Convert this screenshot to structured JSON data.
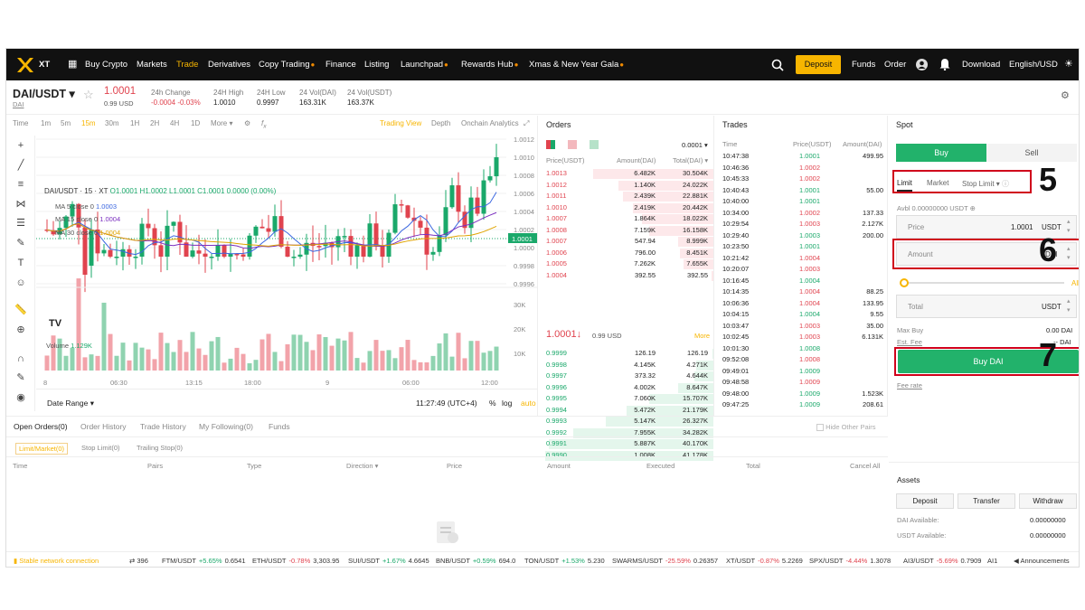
{
  "nav": {
    "logo": "XT",
    "items": [
      "Buy Crypto",
      "Markets",
      "Trade",
      "Derivatives",
      "Copy Trading",
      "Finance",
      "Listing",
      "Launchpad",
      "Rewards Hub",
      "Xmas & New Year Gala"
    ],
    "deposit": "Deposit",
    "funds": "Funds",
    "order": "Order",
    "download": "Download",
    "locale": "English/USD"
  },
  "pair": {
    "name": "DAI/USDT",
    "base": "DAI",
    "price": "1.0001",
    "price_usd": "0.99 USD",
    "change_label": "24h Change",
    "change_value": "-0.0004 -0.03%",
    "high_label": "24H High",
    "high_value": "1.0010",
    "low_label": "24H Low",
    "low_value": "0.9997",
    "vol_label": "24 Vol(DAI)",
    "vol_value": "163.31K",
    "vol2_label": "24 Vol(USDT)",
    "vol2_value": "163.37K"
  },
  "chart": {
    "timeframes": [
      "Time",
      "1m",
      "5m",
      "15m",
      "30m",
      "1H",
      "2H",
      "4H",
      "1D",
      "More"
    ],
    "views": [
      "Trading View",
      "Depth",
      "Onchain Analytics"
    ],
    "legend_title": "DAI/USDT · 15 · XT",
    "ohlc": "O1.0001 H1.0002 L1.0001 C1.0001 0.0000 (0.00%)",
    "ma5": "MA 5 close 0",
    "ma5_val": "1.0003",
    "ma15": "MA 15 close 0",
    "ma15_val": "1.0004",
    "ma30": "MA 30 close 0",
    "ma30_val": "1.0004",
    "yticks": [
      "1.0012",
      "1.0010",
      "1.0008",
      "1.0006",
      "1.0004",
      "1.0002",
      "1.0000",
      "0.9998",
      "0.9996"
    ],
    "current": "1.0001",
    "volume_label": "Volume",
    "volume_val": "1.129K",
    "vticks": [
      "30K",
      "20K",
      "10K"
    ],
    "xticks": [
      "8",
      "06:30",
      "13:15",
      "18:00",
      "9",
      "06:00",
      "12:00"
    ],
    "date_range": "Date Range",
    "clock": "11:27:49 (UTC+4)",
    "pct": "%",
    "log": "log",
    "auto": "auto"
  },
  "chart_data": {
    "type": "candlestick",
    "title": "DAI/USDT · 15 · XT",
    "ylim": [
      0.9996,
      1.0012
    ],
    "last": 1.0001
  },
  "orders": {
    "title": "Orders",
    "precision": "0.0001",
    "headers": [
      "Price(USDT)",
      "Amount(DAI)",
      "Total(DAI)"
    ],
    "asks": [
      [
        "1.0013",
        "6.482K",
        "30.504K"
      ],
      [
        "1.0012",
        "1.140K",
        "24.022K"
      ],
      [
        "1.0011",
        "2.439K",
        "22.881K"
      ],
      [
        "1.0010",
        "2.419K",
        "20.442K"
      ],
      [
        "1.0007",
        "1.864K",
        "18.022K"
      ],
      [
        "1.0008",
        "7.159K",
        "16.158K"
      ],
      [
        "1.0007",
        "547.94",
        "8.999K"
      ],
      [
        "1.0006",
        "796.00",
        "8.451K"
      ],
      [
        "1.0005",
        "7.262K",
        "7.655K"
      ],
      [
        "1.0004",
        "392.55",
        "392.55"
      ]
    ],
    "mid_price": "1.0001↓",
    "mid_usd": "0.99 USD",
    "more": "More",
    "bids": [
      [
        "0.9999",
        "126.19",
        "126.19"
      ],
      [
        "0.9998",
        "4.145K",
        "4.271K"
      ],
      [
        "0.9997",
        "373.32",
        "4.644K"
      ],
      [
        "0.9996",
        "4.002K",
        "8.647K"
      ],
      [
        "0.9995",
        "7.060K",
        "15.707K"
      ],
      [
        "0.9994",
        "5.472K",
        "21.179K"
      ],
      [
        "0.9993",
        "5.147K",
        "26.327K"
      ],
      [
        "0.9992",
        "7.955K",
        "34.282K"
      ],
      [
        "0.9991",
        "5.887K",
        "40.170K"
      ],
      [
        "0.9990",
        "1.008K",
        "41.178K"
      ]
    ]
  },
  "trades": {
    "title": "Trades",
    "headers": [
      "Time",
      "Price(USDT)",
      "Amount(DAI)"
    ],
    "rows": [
      [
        "10:47:38",
        "1.0001",
        "499.95",
        "g"
      ],
      [
        "10:46:36",
        "1.0002",
        "",
        "r"
      ],
      [
        "10:45:33",
        "1.0002",
        "",
        "r"
      ],
      [
        "10:40:43",
        "1.0001",
        "55.00",
        "g"
      ],
      [
        "10:40:00",
        "1.0001",
        "",
        "g"
      ],
      [
        "10:34:00",
        "1.0002",
        "137.33",
        "r"
      ],
      [
        "10:29:54",
        "1.0003",
        "2.127K",
        "r"
      ],
      [
        "10:29:40",
        "1.0003",
        "200.00",
        "g"
      ],
      [
        "10:23:50",
        "1.0001",
        "",
        "g"
      ],
      [
        "10:21:42",
        "1.0004",
        "",
        "r"
      ],
      [
        "10:20:07",
        "1.0003",
        "",
        "r"
      ],
      [
        "10:16:45",
        "1.0004",
        "",
        "g"
      ],
      [
        "10:14:35",
        "1.0004",
        "88.25",
        "r"
      ],
      [
        "10:06:36",
        "1.0004",
        "133.95",
        "r"
      ],
      [
        "10:04:15",
        "1.0004",
        "9.55",
        "g"
      ],
      [
        "10:03:47",
        "1.0003",
        "35.00",
        "r"
      ],
      [
        "10:02:45",
        "1.0003",
        "6.131K",
        "r"
      ],
      [
        "10:01:30",
        "1.0008",
        "",
        "g"
      ],
      [
        "09:52:08",
        "1.0008",
        "",
        "r"
      ],
      [
        "09:49:01",
        "1.0009",
        "",
        "g"
      ],
      [
        "09:48:58",
        "1.0009",
        "",
        "r"
      ],
      [
        "09:48:00",
        "1.0009",
        "1.523K",
        "g"
      ],
      [
        "09:47:25",
        "1.0009",
        "208.61",
        "g"
      ]
    ]
  },
  "spot": {
    "title": "Spot",
    "buy_tab": "Buy",
    "sell_tab": "Sell",
    "order_types": [
      "Limit",
      "Market",
      "Stop Limit"
    ],
    "avbl": "Avbl 0.00000000 USDT",
    "price_label": "Price",
    "price_value": "1.0001",
    "price_unit": "USDT",
    "amount_label": "Amount",
    "amount_unit": "DAI",
    "all": "All",
    "total_label": "Total",
    "total_unit": "USDT",
    "max_buy_label": "Max Buy",
    "max_buy_value": "0.00 DAI",
    "est_fee_label": "Est. Fee",
    "est_fee_value": "-- DAI",
    "buy_button": "Buy DAI",
    "fee_rate": "Fee rate",
    "assets": "Assets",
    "asset_buttons": [
      "Deposit",
      "Transfer",
      "Withdraw"
    ],
    "dai_available_label": "DAI Available:",
    "dai_available_value": "0.00000000",
    "usdt_available_label": "USDT Available:",
    "usdt_available_value": "0.00000000",
    "step5": "5",
    "step6": "6",
    "step7": "7"
  },
  "bottom": {
    "tabs": [
      "Open Orders(0)",
      "Order History",
      "Trade History",
      "My Following(0)",
      "Funds"
    ],
    "hide_other": "Hide Other Pairs",
    "subtabs": [
      "Limit/Market(0)",
      "Stop Limit(0)",
      "Trailing Stop(0)"
    ],
    "columns": [
      "Time",
      "Pairs",
      "Type",
      "Direction",
      "Price",
      "Amount",
      "Executed",
      "Total",
      "Cancel All"
    ]
  },
  "ticker": {
    "connection": "Stable network connection",
    "count": "396",
    "items": [
      [
        "FTM/USDT",
        "+5.65%",
        "0.6541",
        "g"
      ],
      [
        "ETH/USDT",
        "-0.78%",
        "3,303.95",
        "r"
      ],
      [
        "SUI/USDT",
        "+1.67%",
        "4.6645",
        "g"
      ],
      [
        "BNB/USDT",
        "+0.59%",
        "694.0",
        "g"
      ],
      [
        "TON/USDT",
        "+1.53%",
        "5.230",
        "g"
      ],
      [
        "SWARMS/USDT",
        "-25.59%",
        "0.26357",
        "r"
      ],
      [
        "XT/USDT",
        "-0.87%",
        "5.2269",
        "r"
      ],
      [
        "SPX/USDT",
        "-4.44%",
        "1.3078",
        "r"
      ],
      [
        "AI3/USDT",
        "-5.69%",
        "0.7909",
        "r"
      ]
    ],
    "ai": "AI1",
    "announcements": "Announcements"
  },
  "colors": {
    "up": "#1aa86a",
    "down": "#e0434e",
    "accent": "#f7b500",
    "buy": "#22b26b",
    "annotation": "#d0021b"
  }
}
